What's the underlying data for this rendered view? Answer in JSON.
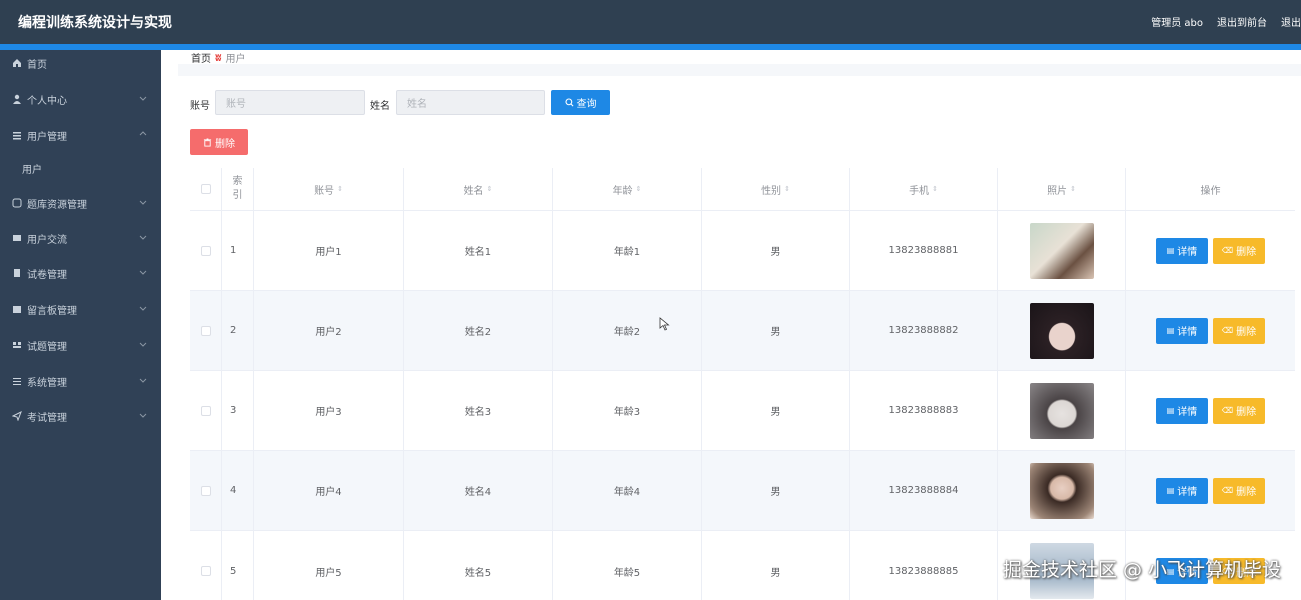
{
  "header": {
    "title": "编程训练系统设计与实现",
    "user": "管理员 abo",
    "to_front": "退出到前台",
    "logout": "退出"
  },
  "sidebar": {
    "items": [
      {
        "label": "首页",
        "icon": "home-icon"
      },
      {
        "label": "个人中心",
        "icon": "user-icon"
      },
      {
        "label": "用户管理",
        "icon": "users-icon"
      },
      {
        "label": "题库资源管理",
        "icon": "database-icon"
      },
      {
        "label": "用户交流",
        "icon": "chat-icon"
      },
      {
        "label": "试卷管理",
        "icon": "paper-icon"
      },
      {
        "label": "留言板管理",
        "icon": "message-icon"
      },
      {
        "label": "试题管理",
        "icon": "question-icon"
      },
      {
        "label": "系统管理",
        "icon": "settings-icon"
      },
      {
        "label": "考试管理",
        "icon": "send-icon"
      }
    ],
    "sub_item": "用户"
  },
  "breadcrumb": {
    "home": "首页",
    "current": "用户"
  },
  "search": {
    "account_label": "账号",
    "account_placeholder": "账号",
    "name_label": "姓名",
    "name_placeholder": "姓名",
    "query_button": "查询"
  },
  "toolbar": {
    "delete_button": "删除"
  },
  "table": {
    "columns": [
      "索引",
      "账号",
      "姓名",
      "年龄",
      "性别",
      "手机",
      "照片",
      "操作"
    ],
    "rows": [
      {
        "index": "1",
        "account": "用户1",
        "name": "姓名1",
        "age": "年龄1",
        "gender": "男",
        "phone": "13823888881"
      },
      {
        "index": "2",
        "account": "用户2",
        "name": "姓名2",
        "age": "年龄2",
        "gender": "男",
        "phone": "13823888882"
      },
      {
        "index": "3",
        "account": "用户3",
        "name": "姓名3",
        "age": "年龄3",
        "gender": "男",
        "phone": "13823888883"
      },
      {
        "index": "4",
        "account": "用户4",
        "name": "姓名4",
        "age": "年龄4",
        "gender": "男",
        "phone": "13823888884"
      },
      {
        "index": "5",
        "account": "用户5",
        "name": "姓名5",
        "age": "年龄5",
        "gender": "男",
        "phone": "13823888885"
      }
    ],
    "detail_button": "详情",
    "delete_button": "删除"
  },
  "watermark": "掘金技术社区 @ 小飞计算机毕设",
  "colors": {
    "primary": "#1e88e5",
    "danger": "#f56c6c",
    "warning": "#f7ba2a",
    "sidebar": "#304156",
    "header": "#2f4051"
  }
}
